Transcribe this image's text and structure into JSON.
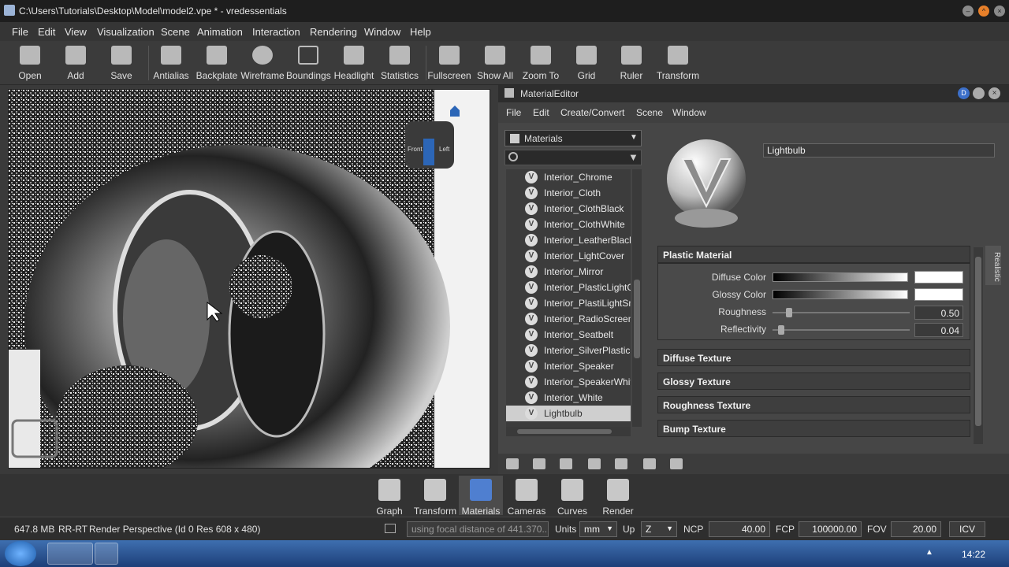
{
  "window": {
    "title": "C:\\Users\\Tutorials\\Desktop\\Model\\model2.vpe * - vredessentials"
  },
  "menubar": [
    "File",
    "Edit",
    "View",
    "Visualization",
    "Scene",
    "Animation",
    "Interaction",
    "Rendering",
    "Window",
    "Help"
  ],
  "toolbar": [
    {
      "label": "Open",
      "icon": "folder-open-icon"
    },
    {
      "label": "Add",
      "icon": "add-file-icon"
    },
    {
      "label": "Save",
      "icon": "save-icon"
    },
    {
      "label": "Antialias",
      "icon": "antialias-icon"
    },
    {
      "label": "Backplate",
      "icon": "backplate-icon"
    },
    {
      "label": "Wireframe",
      "icon": "wireframe-icon"
    },
    {
      "label": "Boundings",
      "icon": "boundings-icon"
    },
    {
      "label": "Headlight",
      "icon": "headlight-icon"
    },
    {
      "label": "Statistics",
      "icon": "statistics-icon"
    },
    {
      "label": "Fullscreen",
      "icon": "fullscreen-icon"
    },
    {
      "label": "Show All",
      "icon": "show-all-icon"
    },
    {
      "label": "Zoom To",
      "icon": "zoom-to-icon"
    },
    {
      "label": "Grid",
      "icon": "grid-icon"
    },
    {
      "label": "Ruler",
      "icon": "ruler-icon"
    },
    {
      "label": "Transform",
      "icon": "transform-icon"
    }
  ],
  "viewport": {
    "navcube_front": "Front",
    "navcube_left": "Left"
  },
  "material_editor": {
    "title": "MaterialEditor",
    "menu": [
      "File",
      "Edit",
      "Create/Convert",
      "Scene",
      "Window"
    ],
    "selector": "Materials",
    "items": [
      "Interior_Chrome",
      "Interior_Cloth",
      "Interior_ClothBlack",
      "Interior_ClothWhite",
      "Interior_LeatherBlack",
      "Interior_LightCover",
      "Interior_Mirror",
      "Interior_PlasticLightG",
      "Interior_PlastiLightSm",
      "Interior_RadioScreen",
      "Interior_Seatbelt",
      "Interior_SilverPlasticS",
      "Interior_Speaker",
      "Interior_SpeakerWhit",
      "Interior_White",
      "Lightbulb"
    ],
    "selected": "Lightbulb",
    "name": "Lightbulb",
    "realistic_tab": "Realistic",
    "plastic": {
      "header": "Plastic Material",
      "diffuse_label": "Diffuse Color",
      "glossy_label": "Glossy Color",
      "roughness_label": "Roughness",
      "roughness_value": "0.50",
      "roughness_level": 0.1,
      "reflectivity_label": "Reflectivity",
      "reflectivity_value": "0.04",
      "reflectivity_level": 0.04
    },
    "sections": [
      "Diffuse Texture",
      "Glossy Texture",
      "Roughness Texture",
      "Bump Texture"
    ]
  },
  "dock": [
    {
      "label": "Graph",
      "icon": "graph-icon"
    },
    {
      "label": "Transform",
      "icon": "transform-icon"
    },
    {
      "label": "Materials",
      "icon": "materials-icon"
    },
    {
      "label": "Cameras",
      "icon": "cameras-icon"
    },
    {
      "label": "Curves",
      "icon": "curves-icon"
    },
    {
      "label": "Render",
      "icon": "render-icon"
    }
  ],
  "status": {
    "memory": "647.8 MB",
    "mode": "RR-RT",
    "info": "Render Perspective (Id 0 Res 608 x 480)",
    "message": "using focal distance of 441.370...",
    "units_label": "Units",
    "units_value": "mm",
    "up_label": "Up",
    "up_value": "Z",
    "ncp_label": "NCP",
    "ncp_value": "40.00",
    "fcp_label": "FCP",
    "fcp_value": "100000.00",
    "fov_label": "FOV",
    "fov_value": "20.00",
    "icv": "ICV"
  },
  "taskbar": {
    "clock": "14:22"
  }
}
